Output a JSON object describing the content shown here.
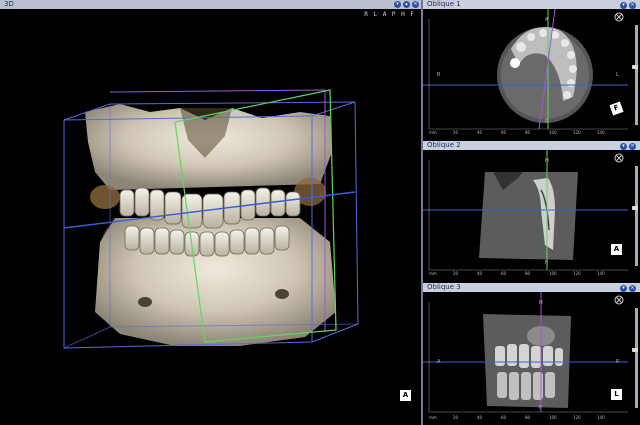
{
  "panel_3d": {
    "title": "3D",
    "orientation_labels": "R L A P H F",
    "view_badge": "A"
  },
  "views": [
    {
      "title": "Oblique 1",
      "top": "A",
      "bottom": "P",
      "left": "R",
      "right": "L",
      "badge": "F",
      "ruler_ticks": [
        "mm",
        "20",
        "40",
        "60",
        "80",
        "100",
        "120",
        "140"
      ]
    },
    {
      "title": "Oblique 2",
      "top": "H",
      "bottom": "F",
      "left": "",
      "right": "",
      "badge": "A",
      "ruler_ticks": [
        "mm",
        "20",
        "40",
        "60",
        "80",
        "100",
        "120",
        "140"
      ]
    },
    {
      "title": "Oblique 3",
      "top": "H",
      "bottom": "F",
      "left": "A",
      "right": "P",
      "badge": "L",
      "ruler_ticks": [
        "mm",
        "20",
        "40",
        "60",
        "80",
        "100",
        "120",
        "140"
      ]
    }
  ],
  "colors": {
    "title_bar": "#b9c0cf",
    "view_title_bar": "#c9cfdc",
    "crosshair_blue": "#3a5fd0",
    "crosshair_green": "#5fd85f",
    "crosshair_purple": "#9a5ad8",
    "bone": "#d9d2c4"
  },
  "icons": [
    "minimize-icon",
    "close-icon",
    "maximize-icon"
  ]
}
